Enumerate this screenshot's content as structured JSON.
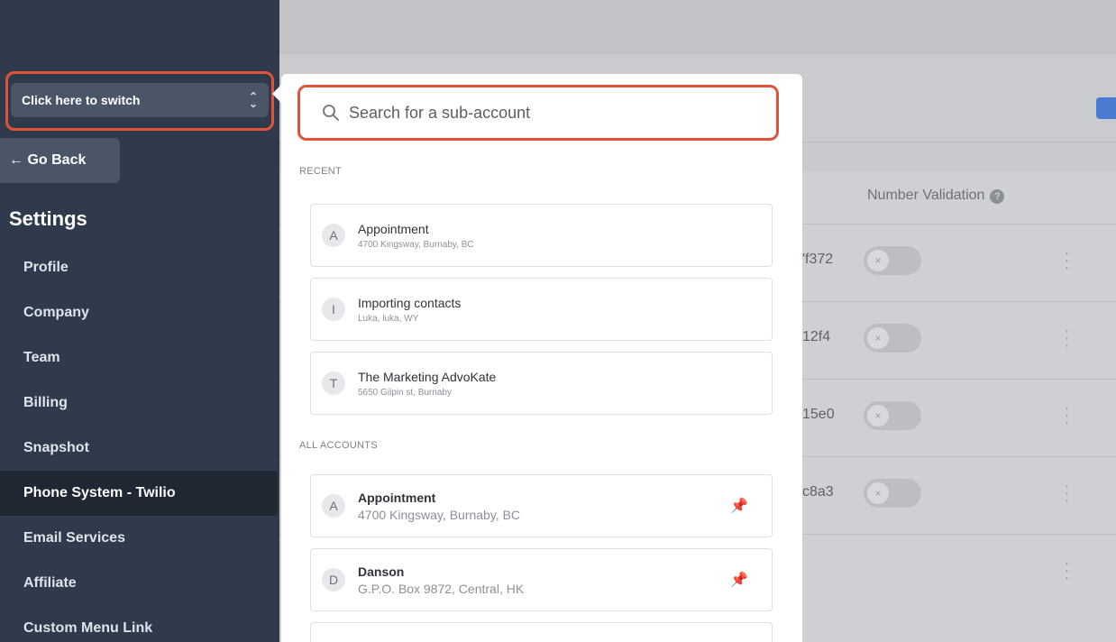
{
  "sidebar": {
    "switcher_label": "Click here to switch",
    "go_back": "← Go Back",
    "section_title": "Settings",
    "items": [
      {
        "label": "Profile"
      },
      {
        "label": "Company"
      },
      {
        "label": "Team"
      },
      {
        "label": "Billing"
      },
      {
        "label": "Snapshot"
      },
      {
        "label": "Phone System - Twilio",
        "active": true
      },
      {
        "label": "Email Services"
      },
      {
        "label": "Affiliate"
      },
      {
        "label": "Custom Menu Link"
      }
    ]
  },
  "background_table": {
    "column_header": "Number Validation",
    "help_icon": "question-circle-icon",
    "rows": [
      {
        "sid_suffix": "'f372"
      },
      {
        "sid_suffix": "12f4"
      },
      {
        "sid_suffix": "15e0"
      },
      {
        "sid_suffix": "c8a3"
      },
      {
        "sid_suffix": ""
      }
    ]
  },
  "switcher_popover": {
    "search": {
      "placeholder": "Search for a sub-account",
      "value": ""
    },
    "recent_label": "RECENT",
    "recent": [
      {
        "initial": "A",
        "name": "Appointment",
        "address": "4700 Kingsway, Burnaby, BC"
      },
      {
        "initial": "I",
        "name": "Importing contacts",
        "address": "Luka, luka, WY"
      },
      {
        "initial": "T",
        "name": "The Marketing AdvoKate",
        "address": "5650 Gilpin st, Burnaby"
      }
    ],
    "all_label": "ALL ACCOUNTS",
    "all_accounts": [
      {
        "initial": "A",
        "name": "Appointment",
        "address": "4700 Kingsway, Burnaby, BC"
      },
      {
        "initial": "D",
        "name": "Danson",
        "address": "G.P.O. Box 9872, Central, HK"
      }
    ]
  },
  "colors": {
    "sidebar_bg": "#2f3a4c",
    "highlight_ring": "#e0533a",
    "accent_blue": "#4a7bd0"
  }
}
